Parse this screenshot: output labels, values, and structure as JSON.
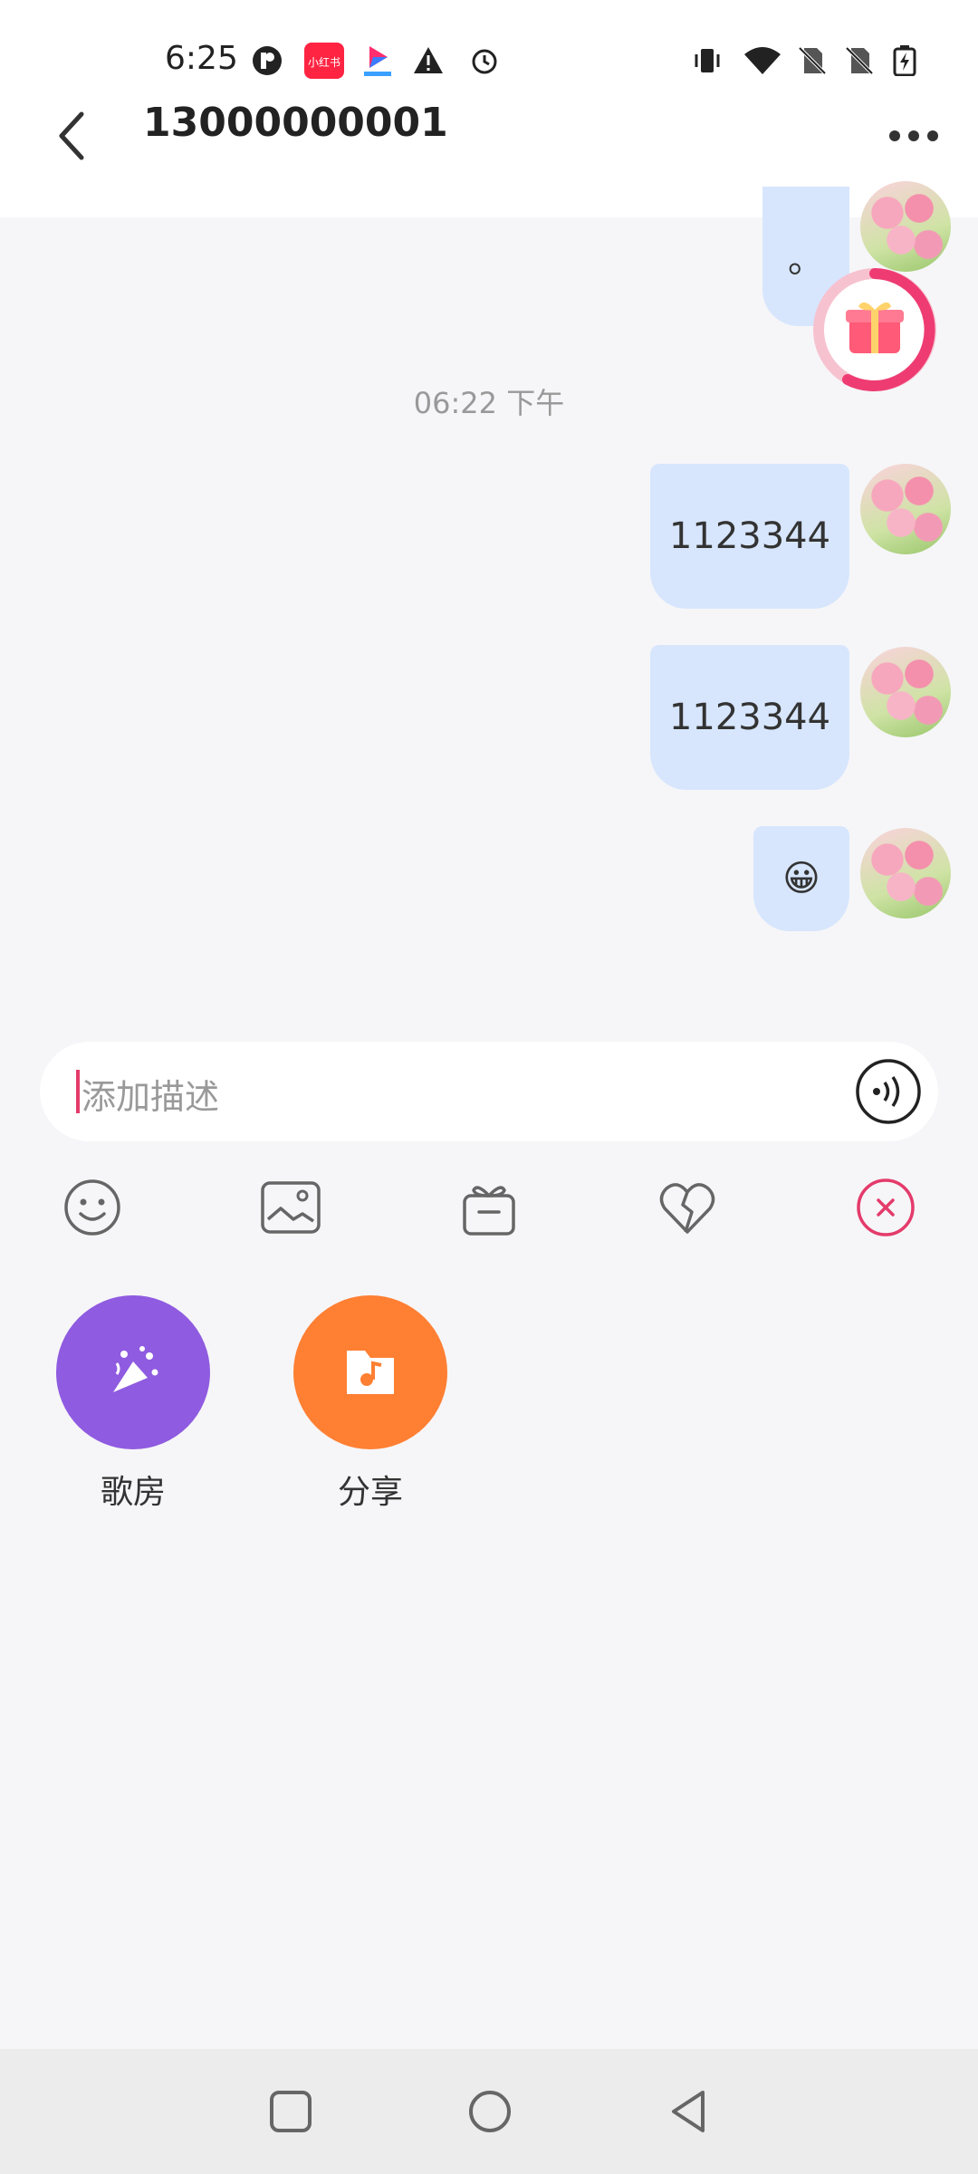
{
  "status_bar": {
    "time": "6:25",
    "app_icons": [
      "pocket-icon",
      "xiaohongshu-icon",
      "video-app-icon",
      "warning-icon",
      "alarm-icon"
    ],
    "system_icons": [
      "vibrate-icon",
      "wifi-icon",
      "no-sim-icon",
      "no-sim-icon",
      "battery-charging-icon"
    ]
  },
  "header": {
    "title": "13000000001",
    "back_icon": "back-arrow-icon",
    "more_icon": "more-dots-icon"
  },
  "messages": [
    {
      "text": "。",
      "sender": "me"
    },
    {
      "text": "1123344",
      "sender": "me"
    },
    {
      "text": "1123344",
      "sender": "me"
    },
    {
      "text": "😀",
      "sender": "me"
    }
  ],
  "timestamp": "06:22 下午",
  "input": {
    "placeholder": "添加描述",
    "voice_icon": "voice-wave-icon"
  },
  "toolbar": [
    "emoji-icon",
    "image-icon",
    "gift-icon",
    "heart-broken-icon",
    "close-circle-icon"
  ],
  "features": [
    {
      "label": "歌房",
      "icon": "karaoke-icon",
      "color": "#8f5be0"
    },
    {
      "label": "分享",
      "icon": "music-folder-icon",
      "color": "#ff7f33"
    }
  ],
  "colors": {
    "accent": "#e43b6b",
    "bubble": "#d7e6fd"
  },
  "nav": [
    "recents-square-icon",
    "home-circle-icon",
    "back-triangle-icon"
  ]
}
